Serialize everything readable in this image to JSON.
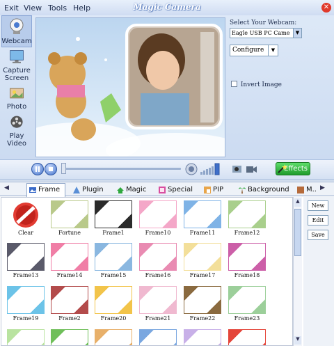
{
  "menu": {
    "exit": "Exit",
    "view": "View",
    "tools": "Tools",
    "help": "Help"
  },
  "app_title": "Magic Camera",
  "sidebar": [
    {
      "label": "Webcam",
      "icon": "webcam-icon"
    },
    {
      "label": "Capture Screen",
      "icon": "monitor-icon"
    },
    {
      "label": "Photo",
      "icon": "photo-icon"
    },
    {
      "label": "Play Video",
      "icon": "film-reel-icon"
    }
  ],
  "webcam": {
    "select_label": "Select Your Webcam:",
    "selected": "Eagle USB PC Came",
    "configure": "Configure",
    "invert": "Invert Image"
  },
  "controls": {
    "effects": "Effects"
  },
  "tabs": [
    {
      "label": "Frame",
      "active": true
    },
    {
      "label": "Plugin"
    },
    {
      "label": "Magic"
    },
    {
      "label": "Special"
    },
    {
      "label": "PIP"
    },
    {
      "label": "Background"
    },
    {
      "label": "M..."
    }
  ],
  "gallery": {
    "items": [
      {
        "label": "Clear",
        "color": "#e23b32"
      },
      {
        "label": "Fortune",
        "color": "#b9c98a"
      },
      {
        "label": "Frame1",
        "color": "#2b2b2b"
      },
      {
        "label": "Frame10",
        "color": "#f4a7c8"
      },
      {
        "label": "Frame11",
        "color": "#7fb3e6"
      },
      {
        "label": "Frame12",
        "color": "#a9cf8c"
      },
      {
        "label": "Frame13",
        "color": "#5a5a6a"
      },
      {
        "label": "Frame14",
        "color": "#f07ea6"
      },
      {
        "label": "Frame15",
        "color": "#8ab7e0"
      },
      {
        "label": "Frame16",
        "color": "#e98bb2"
      },
      {
        "label": "Frame17",
        "color": "#f3df9a"
      },
      {
        "label": "Frame18",
        "color": "#cc5fa8"
      },
      {
        "label": "Frame19",
        "color": "#6cc3e8"
      },
      {
        "label": "Frame2",
        "color": "#b34b4b"
      },
      {
        "label": "Frame20",
        "color": "#f2c44a"
      },
      {
        "label": "Frame21",
        "color": "#f0b9d0"
      },
      {
        "label": "Frame22",
        "color": "#8a6a3f"
      },
      {
        "label": "Frame23",
        "color": "#9ccf9a"
      },
      {
        "label": "",
        "color": "#b9e3a0"
      },
      {
        "label": "",
        "color": "#6fbf5a"
      },
      {
        "label": "",
        "color": "#e8b06a"
      },
      {
        "label": "",
        "color": "#7aa7e0"
      },
      {
        "label": "",
        "color": "#c8b0e8"
      },
      {
        "label": "",
        "color": "#e4453a"
      }
    ]
  },
  "buttons": {
    "new": "New",
    "edit": "Edit",
    "save": "Save"
  }
}
